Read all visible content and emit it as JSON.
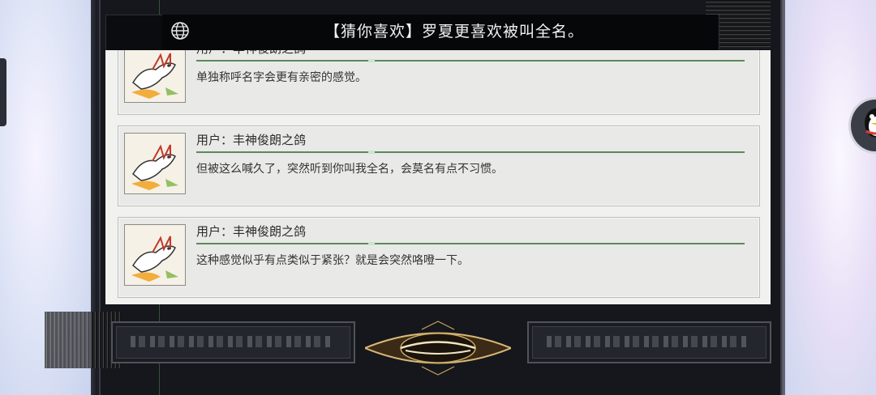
{
  "header": {
    "title": "【猜你喜欢】罗夏更喜欢被叫全名。",
    "icon": "globe-icon"
  },
  "messages": [
    {
      "user": "用户：丰神俊朗之鸽",
      "text": "单独称呼名字会更有亲密的感觉。"
    },
    {
      "user": "用户：丰神俊朗之鸽",
      "text": "但被这么喊久了，突然听到你叫我全名，会莫名有点不习惯。"
    },
    {
      "user": "用户：丰神俊朗之鸽",
      "text": "这种感觉似乎有点类似于紧张？就是会突然咯噔一下。"
    }
  ],
  "footer": {
    "left_button": "",
    "right_button": "",
    "emblem": "eye-emblem"
  },
  "colors": {
    "accent_line": "#5b8a5b",
    "panel": "#f1f1ef",
    "frame": "#15171c"
  }
}
